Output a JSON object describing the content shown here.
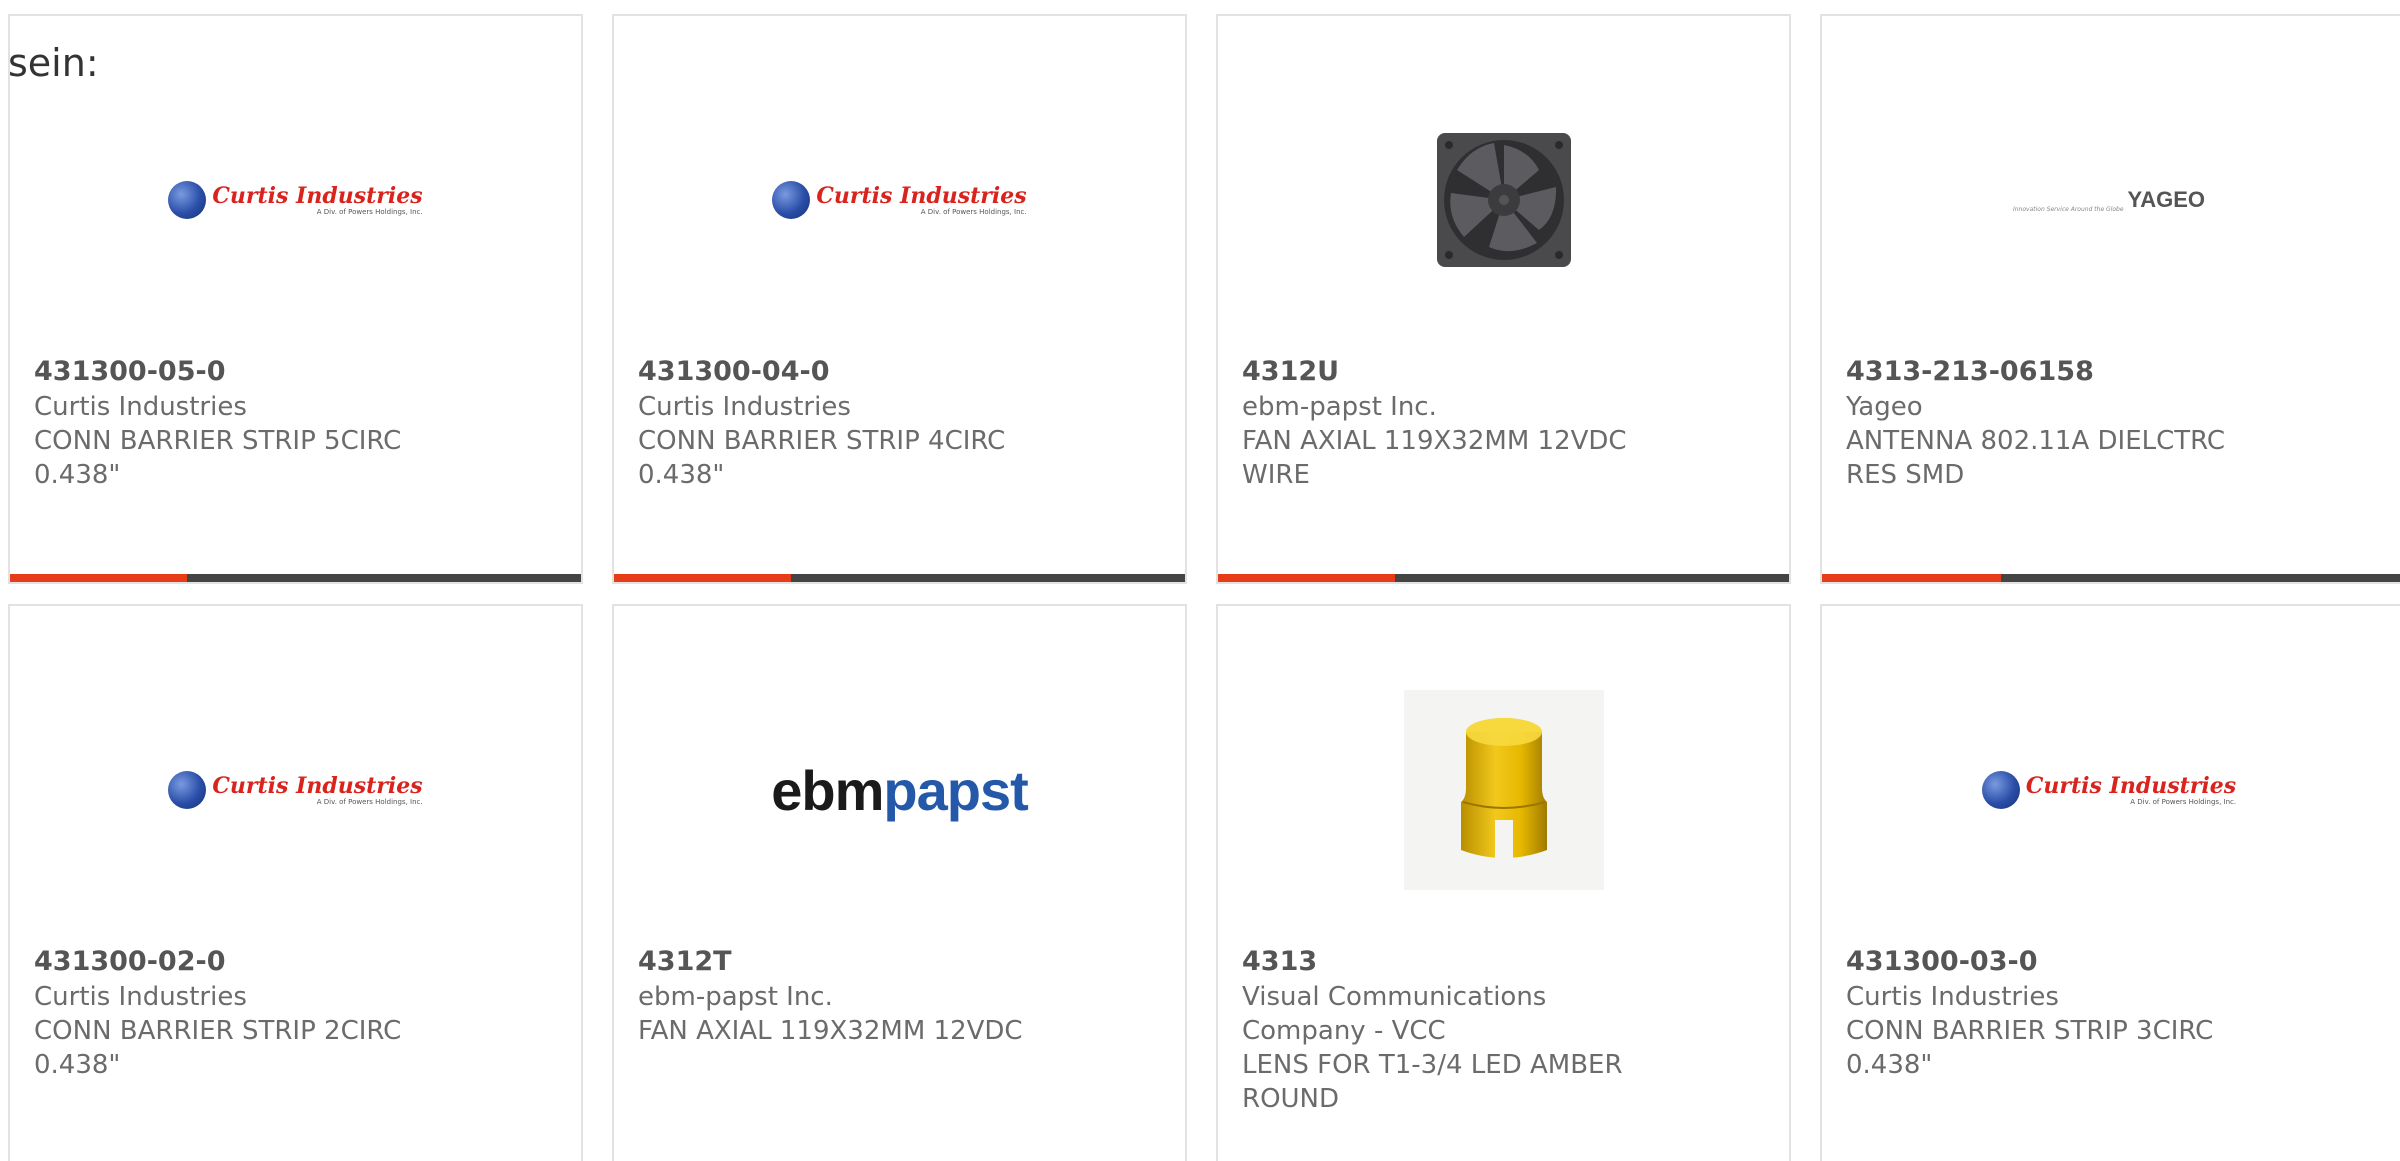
{
  "intro_text": "sein:",
  "colors": {
    "accent": "#e63c17",
    "progress_track": "#444444",
    "card_border": "#e2e2e2",
    "text": "#6b6b6b",
    "part_number": "#555555"
  },
  "cards": [
    {
      "part_number": "431300-05-0",
      "manufacturer": "Curtis Industries",
      "description": "CONN BARRIER STRIP 5CIRC 0.438\"",
      "image": "curtis-industries-logo",
      "progress": 0.31
    },
    {
      "part_number": "431300-04-0",
      "manufacturer": "Curtis Industries",
      "description": "CONN BARRIER STRIP 4CIRC 0.438\"",
      "image": "curtis-industries-logo",
      "progress": 0.31
    },
    {
      "part_number": "4312U",
      "manufacturer": "ebm-papst Inc.",
      "description": "FAN AXIAL 119X32MM 12VDC WIRE",
      "image": "axial-fan-photo",
      "progress": 0.31
    },
    {
      "part_number": "4313-213-06158",
      "manufacturer": "Yageo",
      "description": "ANTENNA 802.11A DIELCTRC RES SMD",
      "image": "yageo-logo",
      "progress": 0.31
    },
    {
      "part_number": "431300-02-0",
      "manufacturer": "Curtis Industries",
      "description": "CONN BARRIER STRIP 2CIRC 0.438\"",
      "image": "curtis-industries-logo"
    },
    {
      "part_number": "4312T",
      "manufacturer": "ebm-papst Inc.",
      "description": "FAN AXIAL 119X32MM 12VDC",
      "image": "ebmpapst-logo"
    },
    {
      "part_number": "4313",
      "manufacturer": "Visual Communications Company - VCC",
      "description": "LENS FOR T1-3/4 LED AMBER ROUND",
      "image": "amber-lens-photo"
    },
    {
      "part_number": "431300-03-0",
      "manufacturer": "Curtis Industries",
      "description": "CONN BARRIER STRIP 3CIRC 0.438\"",
      "image": "curtis-industries-logo"
    }
  ],
  "logos": {
    "curtis_name": "Curtis Industries",
    "curtis_sub": "A Div. of Powers Holdings, Inc.",
    "ebm": "ebm",
    "papst": "papst",
    "yageo_tagline": "Innovation Service Around the Globe",
    "yageo_name": "YAGEO"
  }
}
